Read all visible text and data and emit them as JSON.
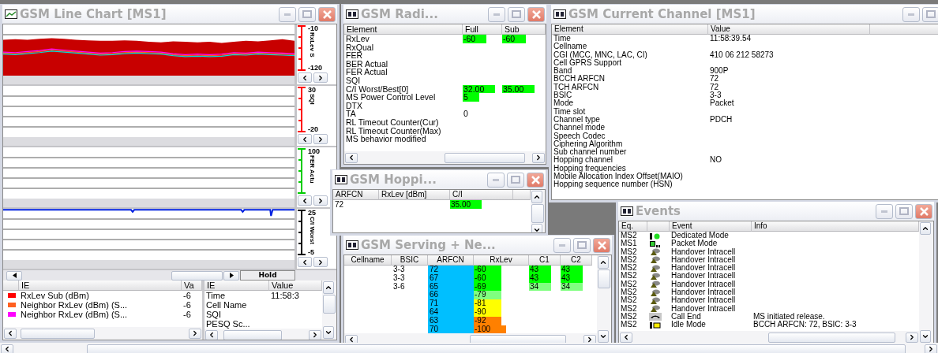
{
  "line_chart": {
    "title": "GSM Line Chart [MS1]",
    "panels": [
      {
        "kind": "area",
        "axis_label": "RxLev S",
        "max": "-10",
        "min": "-120",
        "color": "#ff0000"
      },
      {
        "kind": "empty",
        "axis_label": "SQI",
        "max": "30",
        "min": "-20",
        "color": "#ff0000"
      },
      {
        "kind": "empty",
        "axis_label": "FER Actu",
        "max": "100",
        "color": "#00cc00"
      },
      {
        "kind": "line",
        "axis_label": "C/I Worst",
        "max": "25",
        "min": "-5",
        "color": "#000000"
      }
    ],
    "hold": "Hold",
    "legend": {
      "columns": [
        "IE",
        "Va"
      ],
      "rows": [
        {
          "color": "#ff0000",
          "ie": "RxLev Sub (dBm)",
          "value": "-6"
        },
        {
          "color": "#ff6020",
          "ie": "Neighbor RxLev (dBm) (S...",
          "value": "-6"
        },
        {
          "color": "#ff00ff",
          "ie": "Neighbor RxLev (dBm) (S...",
          "value": "-6"
        }
      ]
    },
    "info": {
      "columns": [
        "IE",
        "Value"
      ],
      "rows": [
        {
          "ie": "Time",
          "value": "11:58:3"
        },
        {
          "ie": "Cell Name"
        },
        {
          "ie": "SQI"
        },
        {
          "ie": "PESQ Sc..."
        }
      ]
    }
  },
  "radio": {
    "title": "GSM Radi...",
    "columns": [
      "Element",
      "Full",
      "Sub"
    ],
    "rows": [
      {
        "element": "RxLev",
        "full": {
          "text": "-60",
          "highlight": true
        },
        "sub": {
          "text": "-60",
          "highlight": true
        }
      },
      {
        "element": "RxQual"
      },
      {
        "element": "FER"
      },
      {
        "element": "BER Actual"
      },
      {
        "element": "FER Actual"
      },
      {
        "element": "SQI"
      },
      {
        "element": "C/I Worst/Best[0]",
        "full": {
          "text": "32.00",
          "highlight": true
        },
        "sub": {
          "text": "35.00",
          "highlight": true
        }
      },
      {
        "element": "MS Power Control Level",
        "full": {
          "text": "5",
          "highlight": true
        }
      },
      {
        "element": "DTX"
      },
      {
        "element": "TA",
        "full": {
          "text": "0",
          "highlight": false
        }
      },
      {
        "element": "RL Timeout Counter(Cur)"
      },
      {
        "element": "RL Timeout Counter(Max)"
      },
      {
        "element": "MS behavior modified"
      }
    ]
  },
  "current_channel": {
    "title": "GSM Current Channel [MS1]",
    "columns": [
      "Element",
      "Value"
    ],
    "rows": [
      {
        "element": "Time",
        "value": "11:58:39.54"
      },
      {
        "element": "Cellname"
      },
      {
        "element": "CGI (MCC, MNC, LAC, CI)",
        "value": "410 06 212 58273"
      },
      {
        "element": "Cell GPRS Support"
      },
      {
        "element": "Band",
        "value": "900P"
      },
      {
        "element": "BCCH ARFCN",
        "value": "72"
      },
      {
        "element": "TCH ARFCN",
        "value": "72"
      },
      {
        "element": "BSIC",
        "value": "3-3"
      },
      {
        "element": "Mode",
        "value": "Packet"
      },
      {
        "element": "Time slot"
      },
      {
        "element": "Channel type",
        "value": "PDCH"
      },
      {
        "element": "Channel mode"
      },
      {
        "element": "Speech Codec"
      },
      {
        "element": "Ciphering Algorithm"
      },
      {
        "element": "Sub channel number"
      },
      {
        "element": "Hopping channel",
        "value": "NO"
      },
      {
        "element": "Hopping frequencies"
      },
      {
        "element": "Mobile Allocation Index Offset(MAIO)"
      },
      {
        "element": "Hopping sequence number (HSN)"
      }
    ]
  },
  "hopping": {
    "title": "GSM Hoppi...",
    "columns": [
      "ARFCN",
      "RxLev [dBm]",
      "C/I"
    ],
    "rows": [
      {
        "arfcn": "72",
        "ci": {
          "text": "35.00",
          "highlight": true
        }
      }
    ]
  },
  "serving": {
    "title": "GSM Serving + Ne...",
    "columns": [
      "Cellname",
      "BSIC",
      "ARFCN",
      "RxLev",
      "C1",
      "C2"
    ],
    "rows": [
      {
        "bsic": "3-3",
        "arfcn": "72",
        "rxlev": {
          "text": "-60",
          "color": "#00ff00"
        },
        "c1": {
          "text": "43",
          "color": "#00ff00"
        },
        "c2": {
          "text": "43",
          "color": "#00ff00"
        }
      },
      {
        "bsic": "3-3",
        "arfcn": "67",
        "rxlev": {
          "text": "-60",
          "color": "#00ff00"
        },
        "c1": {
          "text": "43",
          "color": "#00ff00"
        },
        "c2": {
          "text": "43",
          "color": "#00ff00"
        }
      },
      {
        "bsic": "3-6",
        "arfcn": "65",
        "rxlev": {
          "text": "-69",
          "color": "#00ff00"
        },
        "c1": {
          "text": "34",
          "color": "#80ff80"
        },
        "c2": {
          "text": "34",
          "color": "#80ff80"
        }
      },
      {
        "arfcn": "66",
        "rxlev": {
          "text": "-79",
          "color": "#80ff80"
        }
      },
      {
        "arfcn": "71",
        "rxlev": {
          "text": "-81",
          "color": "#ffff00"
        }
      },
      {
        "arfcn": "64",
        "rxlev": {
          "text": "-90",
          "color": "#ffff00"
        }
      },
      {
        "arfcn": "63",
        "rxlev": {
          "text": "-92",
          "color": "#ff8000"
        }
      },
      {
        "arfcn": "70",
        "rxlev": {
          "text": "-100",
          "color": "#ff8000"
        }
      }
    ]
  },
  "events": {
    "title": "Events",
    "columns": [
      "Eq.",
      "Event",
      "Info"
    ],
    "rows": [
      {
        "eq": "MS2",
        "kind": "dedicated",
        "event": "Dedicated Mode"
      },
      {
        "eq": "MS1",
        "kind": "packet",
        "event": "Packet Mode"
      },
      {
        "eq": "MS2",
        "kind": "handover",
        "event": "Handover Intracell"
      },
      {
        "eq": "MS2",
        "kind": "handover",
        "event": "Handover Intracell"
      },
      {
        "eq": "MS2",
        "kind": "handover",
        "event": "Handover Intracell"
      },
      {
        "eq": "MS2",
        "kind": "handover",
        "event": "Handover Intracell"
      },
      {
        "eq": "MS2",
        "kind": "handover",
        "event": "Handover Intracell"
      },
      {
        "eq": "MS2",
        "kind": "handover",
        "event": "Handover Intracell"
      },
      {
        "eq": "MS2",
        "kind": "handover",
        "event": "Handover Intracell"
      },
      {
        "eq": "MS2",
        "kind": "handover",
        "event": "Handover Intracell"
      },
      {
        "eq": "MS2",
        "kind": "call_end",
        "event": "Call End",
        "info": "MS initiated release."
      },
      {
        "eq": "MS2",
        "kind": "idle",
        "event": "Idle Mode",
        "info": "BCCH ARFCN: 72, BSIC: 3-3"
      }
    ]
  }
}
